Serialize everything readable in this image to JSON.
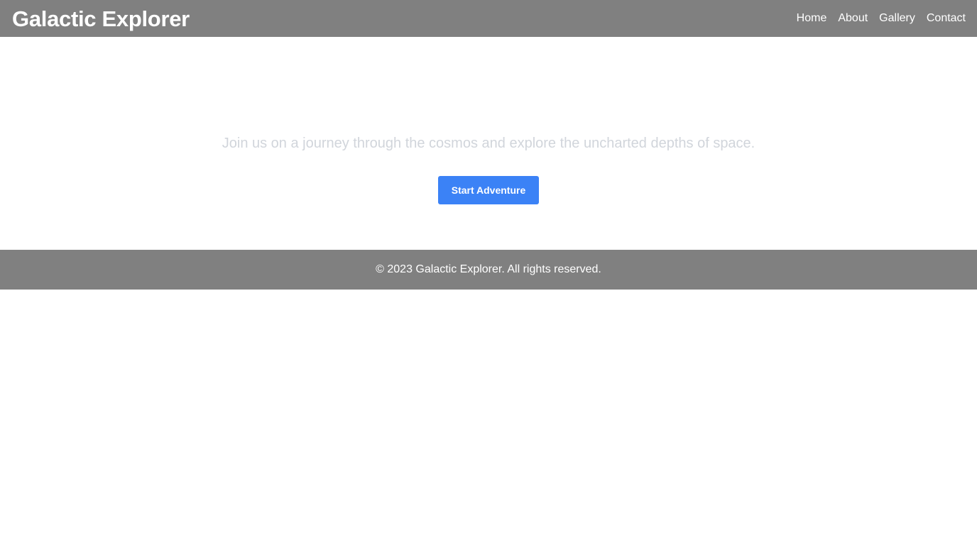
{
  "header": {
    "brand": "Galactic Explorer",
    "nav": [
      {
        "label": "Home"
      },
      {
        "label": "About"
      },
      {
        "label": "Gallery"
      },
      {
        "label": "Contact"
      }
    ]
  },
  "hero": {
    "tagline": "Join us on a journey through the cosmos and explore the uncharted depths of space.",
    "cta_label": "Start Adventure"
  },
  "footer": {
    "copyright": "© 2023 Galactic Explorer. All rights reserved."
  },
  "colors": {
    "header_bg": "#808080",
    "footer_bg": "#808080",
    "accent": "#3b82f6",
    "tagline_text": "#d1d5db"
  }
}
